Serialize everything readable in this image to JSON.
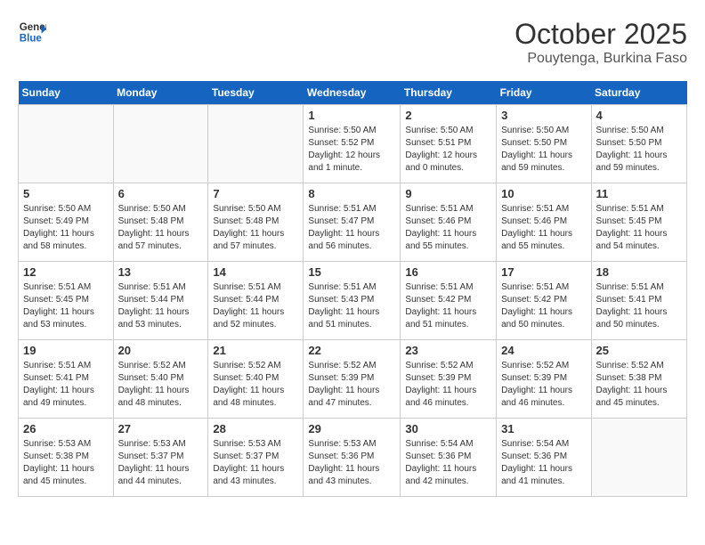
{
  "header": {
    "logo_line1": "General",
    "logo_line2": "Blue",
    "month": "October 2025",
    "location": "Pouytenga, Burkina Faso"
  },
  "weekdays": [
    "Sunday",
    "Monday",
    "Tuesday",
    "Wednesday",
    "Thursday",
    "Friday",
    "Saturday"
  ],
  "weeks": [
    [
      {
        "day": "",
        "info": ""
      },
      {
        "day": "",
        "info": ""
      },
      {
        "day": "",
        "info": ""
      },
      {
        "day": "1",
        "info": "Sunrise: 5:50 AM\nSunset: 5:52 PM\nDaylight: 12 hours and 1 minute."
      },
      {
        "day": "2",
        "info": "Sunrise: 5:50 AM\nSunset: 5:51 PM\nDaylight: 12 hours and 0 minutes."
      },
      {
        "day": "3",
        "info": "Sunrise: 5:50 AM\nSunset: 5:50 PM\nDaylight: 11 hours and 59 minutes."
      },
      {
        "day": "4",
        "info": "Sunrise: 5:50 AM\nSunset: 5:50 PM\nDaylight: 11 hours and 59 minutes."
      }
    ],
    [
      {
        "day": "5",
        "info": "Sunrise: 5:50 AM\nSunset: 5:49 PM\nDaylight: 11 hours and 58 minutes."
      },
      {
        "day": "6",
        "info": "Sunrise: 5:50 AM\nSunset: 5:48 PM\nDaylight: 11 hours and 57 minutes."
      },
      {
        "day": "7",
        "info": "Sunrise: 5:50 AM\nSunset: 5:48 PM\nDaylight: 11 hours and 57 minutes."
      },
      {
        "day": "8",
        "info": "Sunrise: 5:51 AM\nSunset: 5:47 PM\nDaylight: 11 hours and 56 minutes."
      },
      {
        "day": "9",
        "info": "Sunrise: 5:51 AM\nSunset: 5:46 PM\nDaylight: 11 hours and 55 minutes."
      },
      {
        "day": "10",
        "info": "Sunrise: 5:51 AM\nSunset: 5:46 PM\nDaylight: 11 hours and 55 minutes."
      },
      {
        "day": "11",
        "info": "Sunrise: 5:51 AM\nSunset: 5:45 PM\nDaylight: 11 hours and 54 minutes."
      }
    ],
    [
      {
        "day": "12",
        "info": "Sunrise: 5:51 AM\nSunset: 5:45 PM\nDaylight: 11 hours and 53 minutes."
      },
      {
        "day": "13",
        "info": "Sunrise: 5:51 AM\nSunset: 5:44 PM\nDaylight: 11 hours and 53 minutes."
      },
      {
        "day": "14",
        "info": "Sunrise: 5:51 AM\nSunset: 5:44 PM\nDaylight: 11 hours and 52 minutes."
      },
      {
        "day": "15",
        "info": "Sunrise: 5:51 AM\nSunset: 5:43 PM\nDaylight: 11 hours and 51 minutes."
      },
      {
        "day": "16",
        "info": "Sunrise: 5:51 AM\nSunset: 5:42 PM\nDaylight: 11 hours and 51 minutes."
      },
      {
        "day": "17",
        "info": "Sunrise: 5:51 AM\nSunset: 5:42 PM\nDaylight: 11 hours and 50 minutes."
      },
      {
        "day": "18",
        "info": "Sunrise: 5:51 AM\nSunset: 5:41 PM\nDaylight: 11 hours and 50 minutes."
      }
    ],
    [
      {
        "day": "19",
        "info": "Sunrise: 5:51 AM\nSunset: 5:41 PM\nDaylight: 11 hours and 49 minutes."
      },
      {
        "day": "20",
        "info": "Sunrise: 5:52 AM\nSunset: 5:40 PM\nDaylight: 11 hours and 48 minutes."
      },
      {
        "day": "21",
        "info": "Sunrise: 5:52 AM\nSunset: 5:40 PM\nDaylight: 11 hours and 48 minutes."
      },
      {
        "day": "22",
        "info": "Sunrise: 5:52 AM\nSunset: 5:39 PM\nDaylight: 11 hours and 47 minutes."
      },
      {
        "day": "23",
        "info": "Sunrise: 5:52 AM\nSunset: 5:39 PM\nDaylight: 11 hours and 46 minutes."
      },
      {
        "day": "24",
        "info": "Sunrise: 5:52 AM\nSunset: 5:39 PM\nDaylight: 11 hours and 46 minutes."
      },
      {
        "day": "25",
        "info": "Sunrise: 5:52 AM\nSunset: 5:38 PM\nDaylight: 11 hours and 45 minutes."
      }
    ],
    [
      {
        "day": "26",
        "info": "Sunrise: 5:53 AM\nSunset: 5:38 PM\nDaylight: 11 hours and 45 minutes."
      },
      {
        "day": "27",
        "info": "Sunrise: 5:53 AM\nSunset: 5:37 PM\nDaylight: 11 hours and 44 minutes."
      },
      {
        "day": "28",
        "info": "Sunrise: 5:53 AM\nSunset: 5:37 PM\nDaylight: 11 hours and 43 minutes."
      },
      {
        "day": "29",
        "info": "Sunrise: 5:53 AM\nSunset: 5:36 PM\nDaylight: 11 hours and 43 minutes."
      },
      {
        "day": "30",
        "info": "Sunrise: 5:54 AM\nSunset: 5:36 PM\nDaylight: 11 hours and 42 minutes."
      },
      {
        "day": "31",
        "info": "Sunrise: 5:54 AM\nSunset: 5:36 PM\nDaylight: 11 hours and 41 minutes."
      },
      {
        "day": "",
        "info": ""
      }
    ]
  ]
}
